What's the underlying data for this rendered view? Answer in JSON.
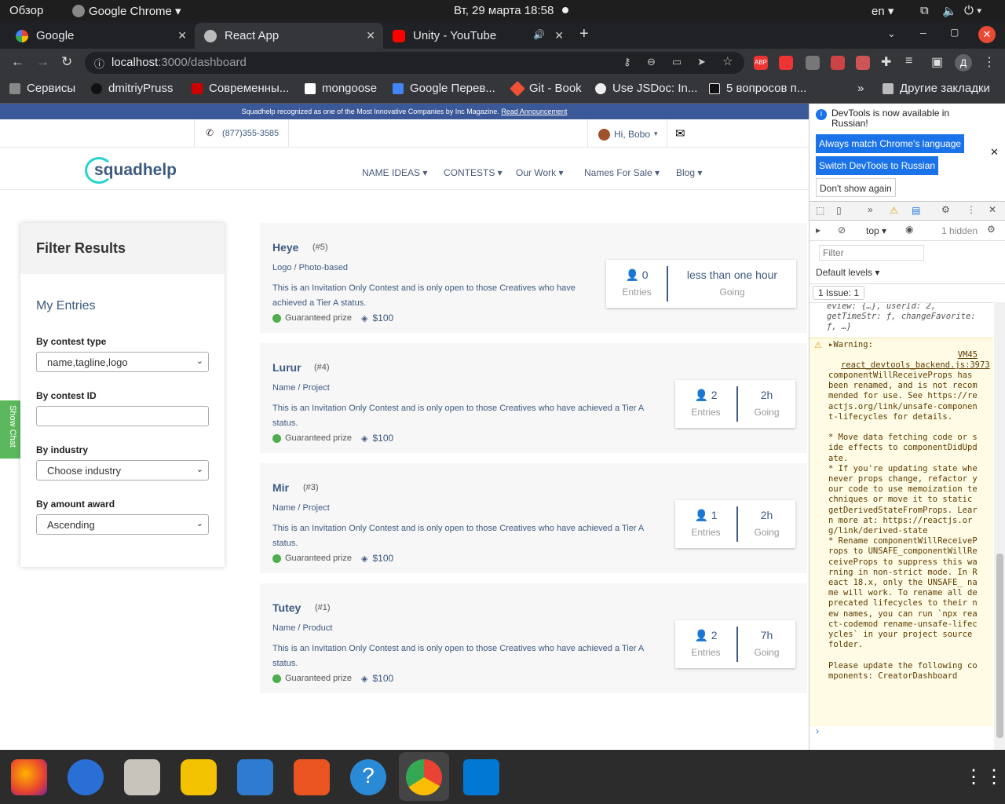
{
  "system": {
    "activities": "Обзор",
    "app": "Google Chrome ▾",
    "clock": "Вт, 29 марта  18:58",
    "lang": "en ▾"
  },
  "tabs": [
    {
      "title": "Google"
    },
    {
      "title": "React App"
    },
    {
      "title": "Unity - YouTube"
    }
  ],
  "address": {
    "host": "localhost",
    "path": ":3000/dashboard"
  },
  "bookmarks": [
    {
      "label": "Сервисы"
    },
    {
      "label": "dmitriyPruss"
    },
    {
      "label": "Современны..."
    },
    {
      "label": "mongoose"
    },
    {
      "label": "Google Перев..."
    },
    {
      "label": "Git - Book"
    },
    {
      "label": "Use JSDoc: In..."
    },
    {
      "label": "5 вопросов п..."
    },
    {
      "label": "Другие закладки"
    }
  ],
  "site": {
    "announcement": "Squadhelp recognized as one of the Most Innovative Companies by Inc Magazine.",
    "announcement_link": "Read Announcement",
    "phone": "(877)355-3585",
    "greeting": "Hi, Bobo",
    "logo": "squadhelp",
    "nav": [
      "NAME IDEAS",
      "CONTESTS",
      "Our Work",
      "Names For Sale",
      "Blog"
    ],
    "show_chat": "Show Chat"
  },
  "filter": {
    "title": "Filter Results",
    "my_entries": "My Entries",
    "contest_type_label": "By contest type",
    "contest_type_value": "name,tagline,logo",
    "contest_id_label": "By contest ID",
    "industry_label": "By industry",
    "industry_value": "Choose industry",
    "award_label": "By amount award",
    "award_value": "Ascending"
  },
  "contests": [
    {
      "title": "Heye",
      "id": "(#5)",
      "type": "Logo / Photo-based",
      "desc": "This is an Invitation Only Contest and is only open to those Creatives who have achieved a Tier A status.",
      "prize_label": "Guaranteed prize",
      "prize": "$100",
      "entries": "0",
      "entries_label": "Entries",
      "time": "less than one hour",
      "time_label": "Going"
    },
    {
      "title": "Lurur",
      "id": "(#4)",
      "type": "Name / Project",
      "desc": "This is an Invitation Only Contest and is only open to those Creatives who have achieved a Tier A status.",
      "prize_label": "Guaranteed prize",
      "prize": "$100",
      "entries": "2",
      "entries_label": "Entries",
      "time": "2h",
      "time_label": "Going"
    },
    {
      "title": "Mir",
      "id": "(#3)",
      "type": "Name / Project",
      "desc": "This is an Invitation Only Contest and is only open to those Creatives who have achieved a Tier A status.",
      "prize_label": "Guaranteed prize",
      "prize": "$100",
      "entries": "1",
      "entries_label": "Entries",
      "time": "2h",
      "time_label": "Going"
    },
    {
      "title": "Tutey",
      "id": "(#1)",
      "type": "Name / Product",
      "desc": "This is an Invitation Only Contest and is only open to those Creatives who have achieved a Tier A status.",
      "prize_label": "Guaranteed prize",
      "prize": "$100",
      "entries": "2",
      "entries_label": "Entries",
      "time": "7h",
      "time_label": "Going"
    }
  ],
  "devtools": {
    "notice": "DevTools is now available in Russian!",
    "btn1": "Always match Chrome's language",
    "btn2": "Switch DevTools to Russian",
    "btn3": "Don't show again",
    "context": "top ▾",
    "hidden": "1 hidden",
    "filter_placeholder": "Filter",
    "levels": "Default levels ▾",
    "issues": "1 Issue:  1",
    "prev_line": "eview: {…}, userId: 2, getTimeStr: ƒ, changeFavorite: ƒ, …}",
    "warn_head": "▸Warning:",
    "warn_link": "VM45 react_devtools_backend.js:3973",
    "warn_body": "componentWillReceiveProps has been renamed, and is not recommended for use. See https://reactjs.org/link/unsafe-component-lifecycles for details.\n\n* Move data fetching code or side effects to componentDidUpdate.\n* If you're updating state whenever props change, refactor your code to use memoization techniques or move it to static getDerivedStateFromProps. Learn more at: https://reactjs.org/link/derived-state\n* Rename componentWillReceiveProps to UNSAFE_componentWillReceiveProps to suppress this warning in non-strict mode. In React 18.x, only the UNSAFE_ name will work. To rename all deprecated lifecycles to their new names, you can run `npx react-codemod rename-unsafe-lifecycles` in your project source folder.\n\nPlease update the following components: CreatorDashboard"
  },
  "colors": {
    "accent": "#3d5a80",
    "announce": "#3b5998",
    "primary": "#1a73e8"
  }
}
